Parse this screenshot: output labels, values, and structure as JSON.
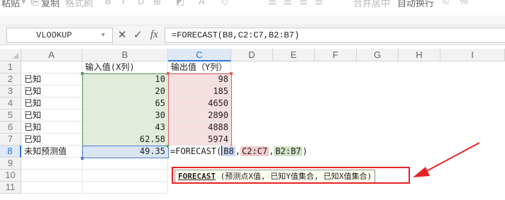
{
  "ribbon": {
    "paste_label": "粘贴",
    "copy_label": "复制",
    "format_painter_label": "格式刷",
    "merge_center_label": "合并居中",
    "wrap_text_label": "自动换行",
    "percent_label": "%"
  },
  "formula_bar": {
    "name_box_value": "VLOOKUP",
    "cancel_icon": "close-icon",
    "confirm_icon": "check-icon",
    "fx_label": "fx",
    "formula": "=FORECAST(B8,C2:C7,B2:B7)"
  },
  "columns": [
    "A",
    "B",
    "C",
    "D",
    "E",
    "F",
    "G",
    "H",
    "I"
  ],
  "rows": [
    "1",
    "2",
    "3",
    "4",
    "5",
    "6",
    "7",
    "8",
    "9",
    "10",
    "11"
  ],
  "cells": {
    "B1": "输入值(X列)",
    "C1": "输出值（Y列）",
    "A2": "已知",
    "B2": "10",
    "C2": "98",
    "A3": "已知",
    "B3": "20",
    "C3": "185",
    "A4": "已知",
    "B4": "65",
    "C4": "4650",
    "A5": "已知",
    "B5": "30",
    "C5": "2890",
    "A6": "已知",
    "B6": "43",
    "C6": "4888",
    "A7": "已知",
    "B7": "62.58",
    "C7": "5974",
    "A8": "未知预测值",
    "B8": "49.35"
  },
  "editor": {
    "prefix": "=FORECAST(",
    "ref1": "B8",
    "sep1": ",",
    "ref2": "C2:C7",
    "sep2": ",",
    "ref3": "B2:B7",
    "suffix": ")"
  },
  "tooltip": {
    "function_name": "FORECAST",
    "signature": "(预测点X值, 已知Y值集合, 已知X值集合)"
  },
  "colors": {
    "accent": "#2f73da",
    "known_x_range": "#e2ecda",
    "known_y_range": "#f6dfe0",
    "target_cell": "#dae5f4",
    "callout": "#e52323"
  }
}
